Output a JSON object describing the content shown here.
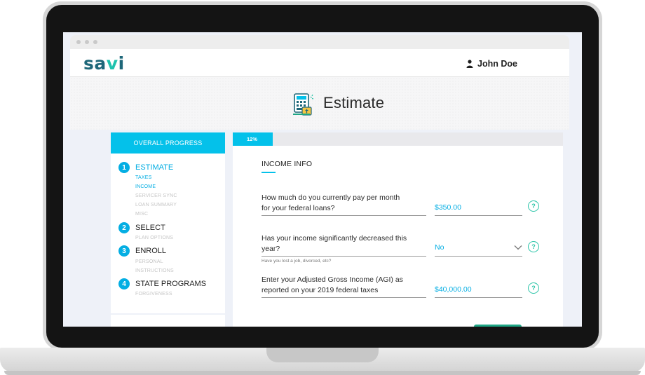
{
  "app": {
    "logo": "sa",
    "logo_accent": "v",
    "logo_end": "i",
    "user_name": "John Doe"
  },
  "page": {
    "title": "Estimate",
    "icon": "calculator-document-icon"
  },
  "sidebar": {
    "header": "OVERALL PROGRESS",
    "steps": [
      {
        "num": "1",
        "label": "ESTIMATE",
        "active": true,
        "substeps": [
          {
            "label": "TAXES",
            "active": true
          },
          {
            "label": "INCOME",
            "active": true
          },
          {
            "label": "SERVICER SYNC",
            "active": false
          },
          {
            "label": "LOAN SUMMARY",
            "active": false
          },
          {
            "label": "MISC",
            "active": false
          }
        ]
      },
      {
        "num": "2",
        "label": "SELECT",
        "active": false,
        "substeps": [
          {
            "label": "PLAN OPTIONS",
            "active": false
          }
        ]
      },
      {
        "num": "3",
        "label": "ENROLL",
        "active": false,
        "substeps": [
          {
            "label": "PERSONAL",
            "active": false
          },
          {
            "label": "INSTRUCTIONS",
            "active": false
          }
        ]
      },
      {
        "num": "4",
        "label": "STATE PROGRAMS",
        "active": false,
        "substeps": [
          {
            "label": "FORGIVENESS",
            "active": false
          }
        ]
      }
    ]
  },
  "progress": {
    "label": "12%",
    "value": 0.12
  },
  "form": {
    "section_title": "INCOME INFO",
    "questions": [
      {
        "line1": "How much do you currently pay per month",
        "line2": "for your federal loans?",
        "value": "$350.00",
        "help": "?"
      },
      {
        "line1": "Has your income significantly decreased this",
        "line2": "year?",
        "hint": "Have you lost a job, divorced, etc?",
        "value": "No",
        "help": "?"
      },
      {
        "line1": "Enter your Adjusted Gross Income (AGI) as",
        "line2": "reported on your 2019 federal taxes",
        "value": "$40,000.00",
        "help": "?"
      }
    ]
  },
  "colors": {
    "accent": "#04c1ea",
    "brand": "#1e6779",
    "help": "#2bc4a8",
    "button": "#1fa786"
  }
}
